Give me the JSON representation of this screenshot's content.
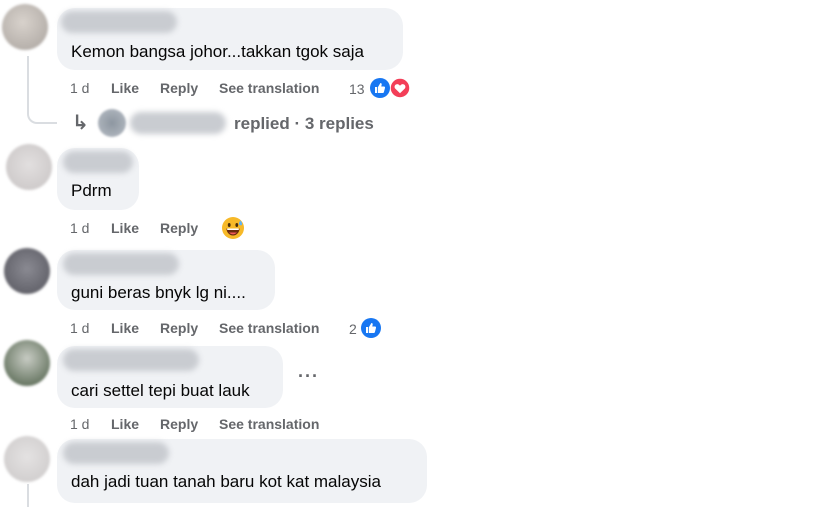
{
  "colors": {
    "like_blue": "#1877f2",
    "love_red": "#f33e58",
    "bubble_bg": "#f0f2f5",
    "meta_gray": "#65676b"
  },
  "comments": [
    {
      "text": "Kemon bangsa johor...takkan tgok saja",
      "time": "1 d",
      "like": "Like",
      "reply": "Reply",
      "see_translation": "See translation",
      "reaction_count": "13",
      "reactions": [
        "like-icon",
        "love-icon"
      ]
    },
    {
      "text": "Pdrm",
      "time": "1 d",
      "like": "Like",
      "reply": "Reply",
      "reactions": [
        "grinning-sweat-emoji"
      ]
    },
    {
      "text": "guni beras bnyk lg ni....",
      "time": "1 d",
      "like": "Like",
      "reply": "Reply",
      "see_translation": "See translation",
      "reaction_count": "2",
      "reactions": [
        "like-icon"
      ]
    },
    {
      "text": "cari settel tepi buat lauk",
      "time": "1 d",
      "like": "Like",
      "reply": "Reply",
      "see_translation": "See translation",
      "more": "···"
    },
    {
      "text": "dah jadi tuan tanah baru kot kat malaysia"
    }
  ],
  "replies_link": {
    "arrow": "↳",
    "text": "replied · 3 replies"
  }
}
